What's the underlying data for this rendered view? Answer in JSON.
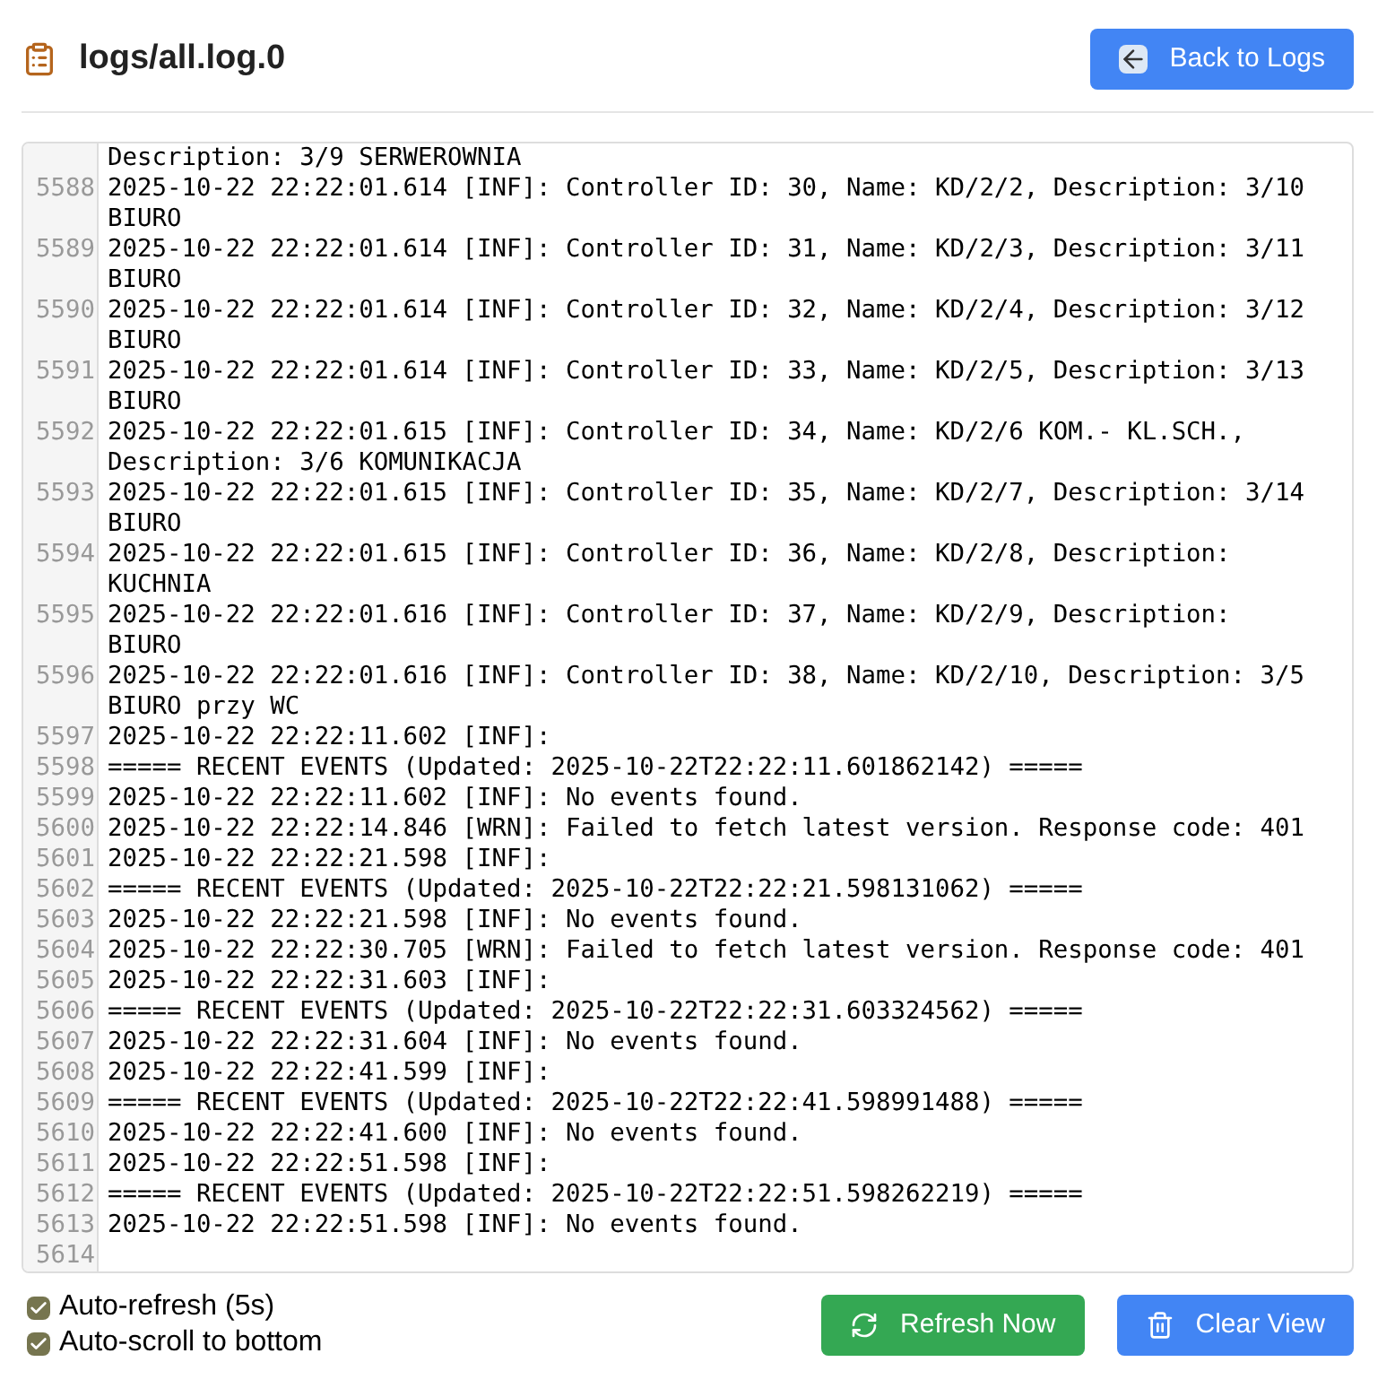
{
  "header": {
    "title": "logs/all.log.0",
    "back_button": "Back to Logs"
  },
  "log": {
    "partial_top_line": "Description: 3/9 SERWEROWNIA",
    "lines": [
      {
        "number": "5588",
        "text": "2025-10-22 22:22:01.614 [INF]: Controller ID: 30, Name: KD/2/2, Description: 3/10 BIURO"
      },
      {
        "number": "5589",
        "text": "2025-10-22 22:22:01.614 [INF]: Controller ID: 31, Name: KD/2/3, Description: 3/11 BIURO"
      },
      {
        "number": "5590",
        "text": "2025-10-22 22:22:01.614 [INF]: Controller ID: 32, Name: KD/2/4, Description: 3/12 BIURO"
      },
      {
        "number": "5591",
        "text": "2025-10-22 22:22:01.614 [INF]: Controller ID: 33, Name: KD/2/5, Description: 3/13 BIURO"
      },
      {
        "number": "5592",
        "text": "2025-10-22 22:22:01.615 [INF]: Controller ID: 34, Name: KD/2/6 KOM.- KL.SCH., Description: 3/6 KOMUNIKACJA"
      },
      {
        "number": "5593",
        "text": "2025-10-22 22:22:01.615 [INF]: Controller ID: 35, Name: KD/2/7, Description: 3/14 BIURO"
      },
      {
        "number": "5594",
        "text": "2025-10-22 22:22:01.615 [INF]: Controller ID: 36, Name: KD/2/8, Description: KUCHNIA"
      },
      {
        "number": "5595",
        "text": "2025-10-22 22:22:01.616 [INF]: Controller ID: 37, Name: KD/2/9, Description: BIURO"
      },
      {
        "number": "5596",
        "text": "2025-10-22 22:22:01.616 [INF]: Controller ID: 38, Name: KD/2/10, Description: 3/5 BIURO przy WC"
      },
      {
        "number": "5597",
        "text": "2025-10-22 22:22:11.602 [INF]:"
      },
      {
        "number": "5598",
        "text": "===== RECENT EVENTS (Updated: 2025-10-22T22:22:11.601862142) ====="
      },
      {
        "number": "5599",
        "text": "2025-10-22 22:22:11.602 [INF]: No events found."
      },
      {
        "number": "5600",
        "text": "2025-10-22 22:22:14.846 [WRN]: Failed to fetch latest version. Response code: 401"
      },
      {
        "number": "5601",
        "text": "2025-10-22 22:22:21.598 [INF]:"
      },
      {
        "number": "5602",
        "text": "===== RECENT EVENTS (Updated: 2025-10-22T22:22:21.598131062) ====="
      },
      {
        "number": "5603",
        "text": "2025-10-22 22:22:21.598 [INF]: No events found."
      },
      {
        "number": "5604",
        "text": "2025-10-22 22:22:30.705 [WRN]: Failed to fetch latest version. Response code: 401"
      },
      {
        "number": "5605",
        "text": "2025-10-22 22:22:31.603 [INF]:"
      },
      {
        "number": "5606",
        "text": "===== RECENT EVENTS (Updated: 2025-10-22T22:22:31.603324562) ====="
      },
      {
        "number": "5607",
        "text": "2025-10-22 22:22:31.604 [INF]: No events found."
      },
      {
        "number": "5608",
        "text": "2025-10-22 22:22:41.599 [INF]:"
      },
      {
        "number": "5609",
        "text": "===== RECENT EVENTS (Updated: 2025-10-22T22:22:41.598991488) ====="
      },
      {
        "number": "5610",
        "text": "2025-10-22 22:22:41.600 [INF]: No events found."
      },
      {
        "number": "5611",
        "text": "2025-10-22 22:22:51.598 [INF]:"
      },
      {
        "number": "5612",
        "text": "===== RECENT EVENTS (Updated: 2025-10-22T22:22:51.598262219) ====="
      },
      {
        "number": "5613",
        "text": "2025-10-22 22:22:51.598 [INF]: No events found."
      },
      {
        "number": "5614"
      }
    ]
  },
  "options": [
    {
      "label": "Auto-refresh (5s)",
      "checked": true
    },
    {
      "label": "Auto-scroll to bottom",
      "checked": true
    }
  ],
  "buttons": [
    {
      "kind": "refresh",
      "label": "Refresh Now"
    },
    {
      "kind": "clear",
      "label": "Clear View"
    }
  ]
}
